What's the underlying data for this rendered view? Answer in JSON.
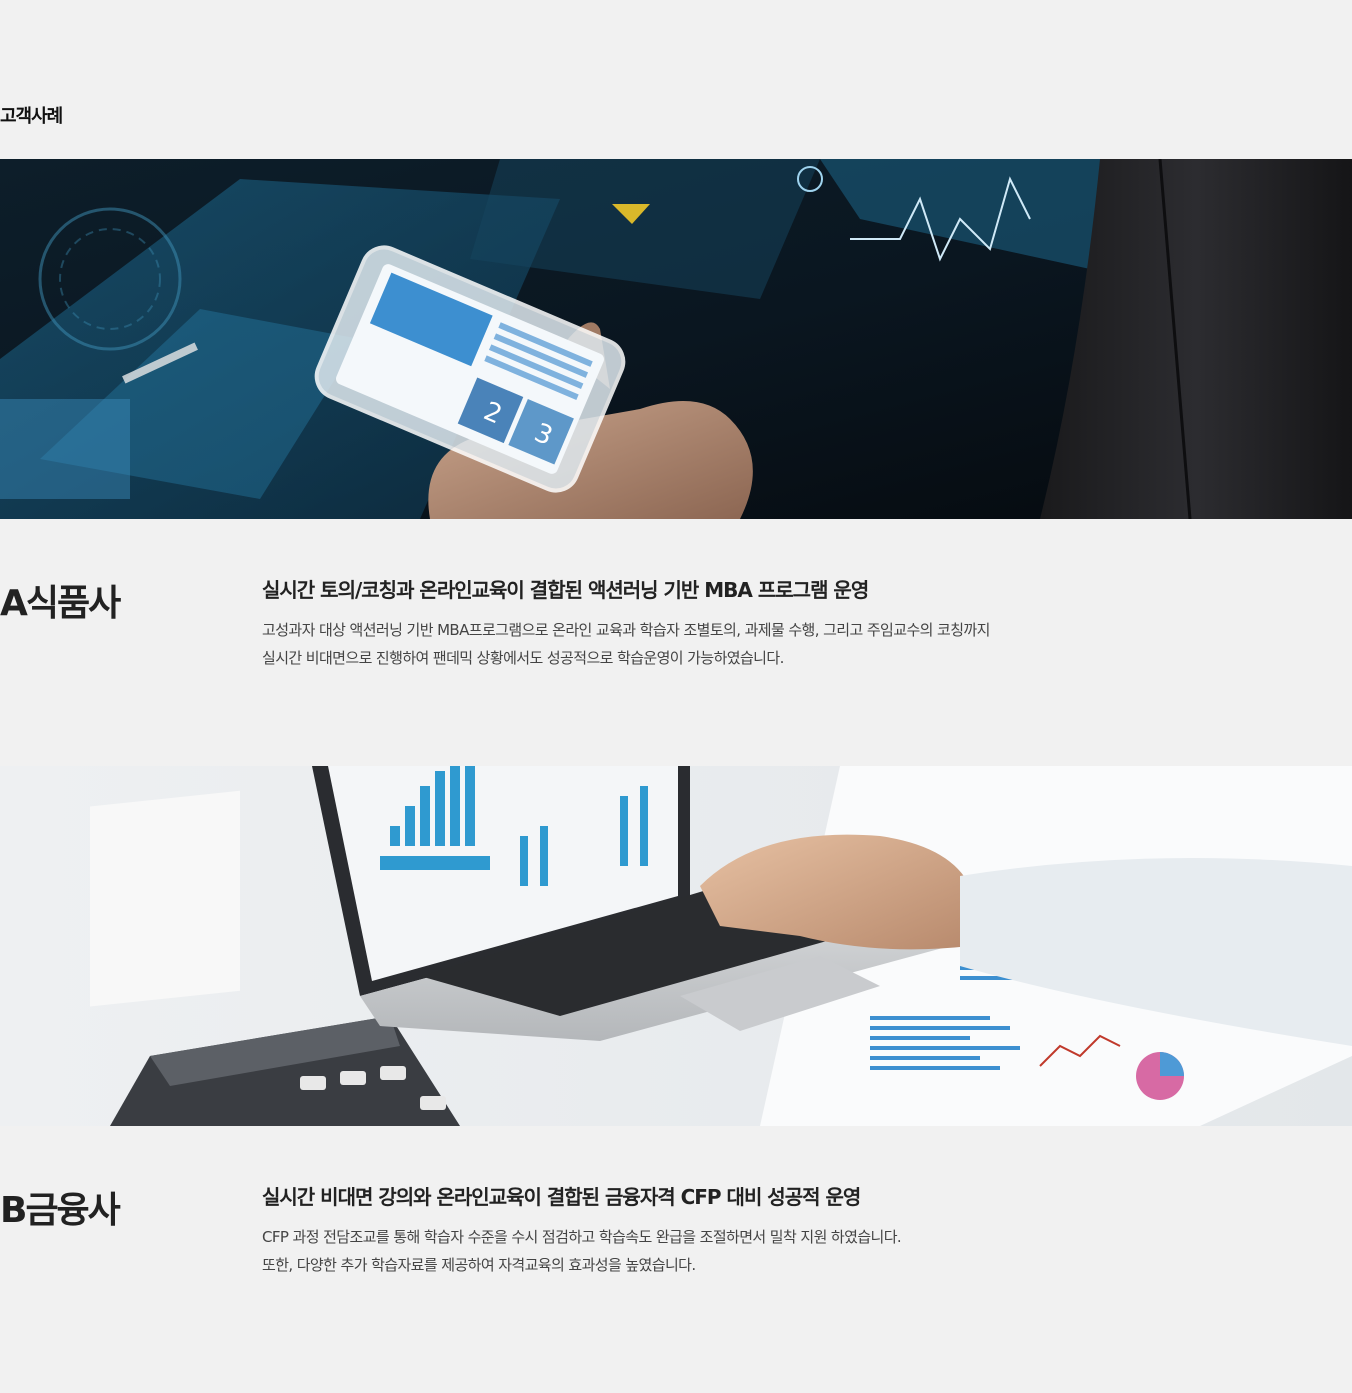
{
  "section": {
    "title": "고객사례"
  },
  "cases": [
    {
      "client": "A식품사",
      "headline": "실시간 토의/코칭과 온라인교육이 결합된 액션러닝 기반 MBA 프로그램 운영",
      "desc_lines": [
        "고성과자 대상 액션러닝 기반 MBA프로그램으로 온라인 교육과 학습자 조별토의, 과제물 수행, 그리고 주임교수의 코칭까지",
        "실시간 비대면으로 진행하여 팬데믹 상황에서도 성공적으로 학습운영이 가능하였습니다."
      ],
      "image": "smartphone-hologram-photo"
    },
    {
      "client": "B금융사",
      "headline": "실시간 비대면 강의와 온라인교육이 결합된 금융자격 CFP 대비 성공적 운영",
      "desc_lines": [
        "CFP 과정 전담조교를 통해 학습자 수준을 수시 점검하고 학습속도 완급을 조절하면서 밀착 지원 하였습니다.",
        "또한, 다양한 추가 학습자료를 제공하여 자격교육의 효과성을 높였습니다."
      ],
      "image": "laptop-charts-photo"
    }
  ],
  "colors": {
    "background": "#f1f1f1",
    "text": "#222222",
    "accent_blue": "#2a7fb8"
  }
}
